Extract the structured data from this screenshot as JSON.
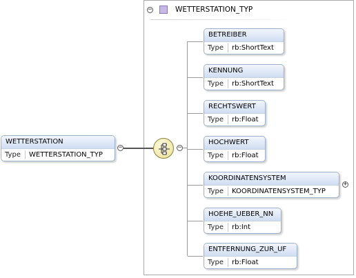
{
  "root": {
    "name": "WETTERSTATION",
    "type_key": "Type",
    "type_value": "WETTERSTATION_TYP"
  },
  "complex_type": {
    "name": "WETTERSTATION_TYP"
  },
  "compositor": {
    "icon": "sequence-compositor-icon"
  },
  "children": [
    {
      "name": "BETREIBER",
      "type_key": "Type",
      "type_value": "rb:ShortText"
    },
    {
      "name": "KENNUNG",
      "type_key": "Type",
      "type_value": "rb:ShortText"
    },
    {
      "name": "RECHTSWERT",
      "type_key": "Type",
      "type_value": "rb:Float"
    },
    {
      "name": "HOCHWERT",
      "type_key": "Type",
      "type_value": "rb:Float"
    },
    {
      "name": "KOORDINATENSYSTEM",
      "type_key": "Type",
      "type_value": "KOORDINATENSYSTEM_TYP",
      "expandable": true
    },
    {
      "name": "HOEHE_UEBER_NN",
      "type_key": "Type",
      "type_value": "rb:Int"
    },
    {
      "name": "ENTFERNUNG_ZUR_UF",
      "type_key": "Type",
      "type_value": "rb:Float"
    }
  ],
  "toggles": {
    "collapse": "−",
    "expand": "+"
  },
  "colors": {
    "header_top": "#f2f6fd",
    "header_bottom": "#cfddf2",
    "border": "#9bb1cc",
    "compositor_fill": "#f1e7a8"
  }
}
